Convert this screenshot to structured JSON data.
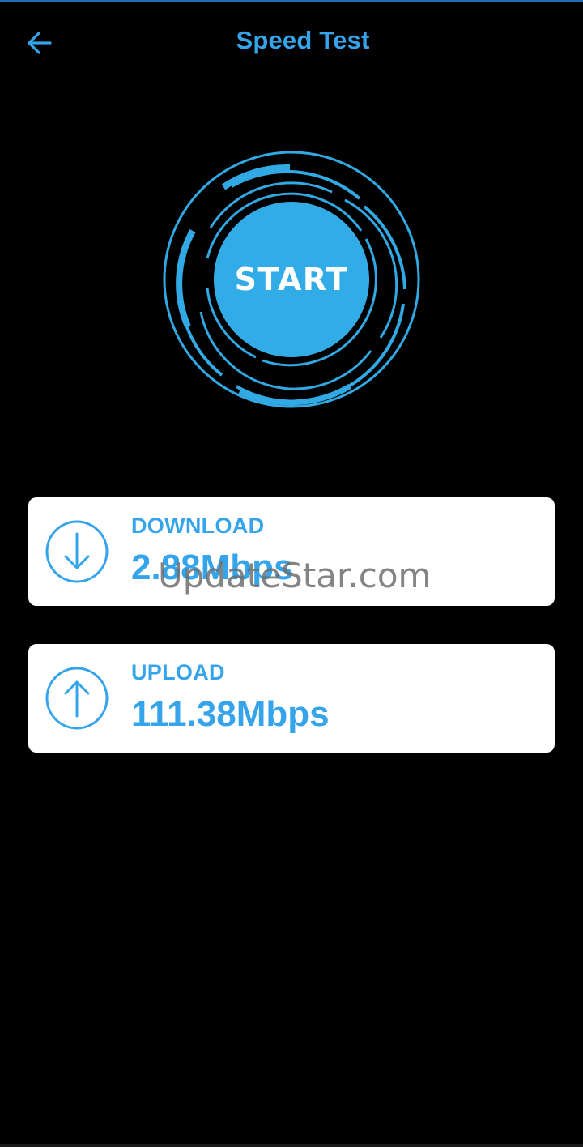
{
  "app_bar": {
    "title": "Speed Test",
    "back_icon": "arrow-left-icon"
  },
  "gauge": {
    "button_label": "START"
  },
  "download": {
    "label": "DOWNLOAD",
    "value": "2.88Mbps",
    "icon": "download-arrow-icon"
  },
  "upload": {
    "label": "UPLOAD",
    "value": "111.38Mbps",
    "icon": "upload-arrow-icon"
  },
  "watermark": "UpdateStar.com",
  "colors": {
    "accent": "#35a4ea",
    "button": "#31ace6",
    "background": "#000000",
    "card": "#ffffff"
  }
}
